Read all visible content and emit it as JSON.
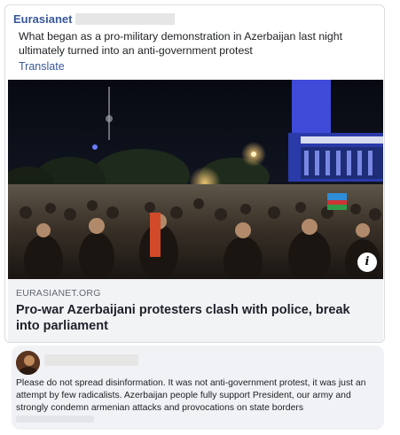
{
  "post": {
    "page_name": "Eurasianet",
    "text": "What began as a pro-military demonstration in Azerbaijan last night ultimately turned into an anti-government protest",
    "translate_label": "Translate"
  },
  "link": {
    "domain": "EURASIANET.ORG",
    "headline": "Pro-war Azerbaijani protesters clash with police, break into parliament",
    "info_symbol": "i"
  },
  "comment": {
    "text": "Please do not spread disinformation. It was not anti-government protest, it was just an attempt by few radicalists. Azerbaijan people fully support President, our army and strongly condemn armenian attacks and provocations on state borders"
  },
  "colors": {
    "link_blue": "#385898",
    "card_bg": "#f2f3f5",
    "comment_bg": "#f0f2f5",
    "building_light": "#3f4bd8"
  }
}
